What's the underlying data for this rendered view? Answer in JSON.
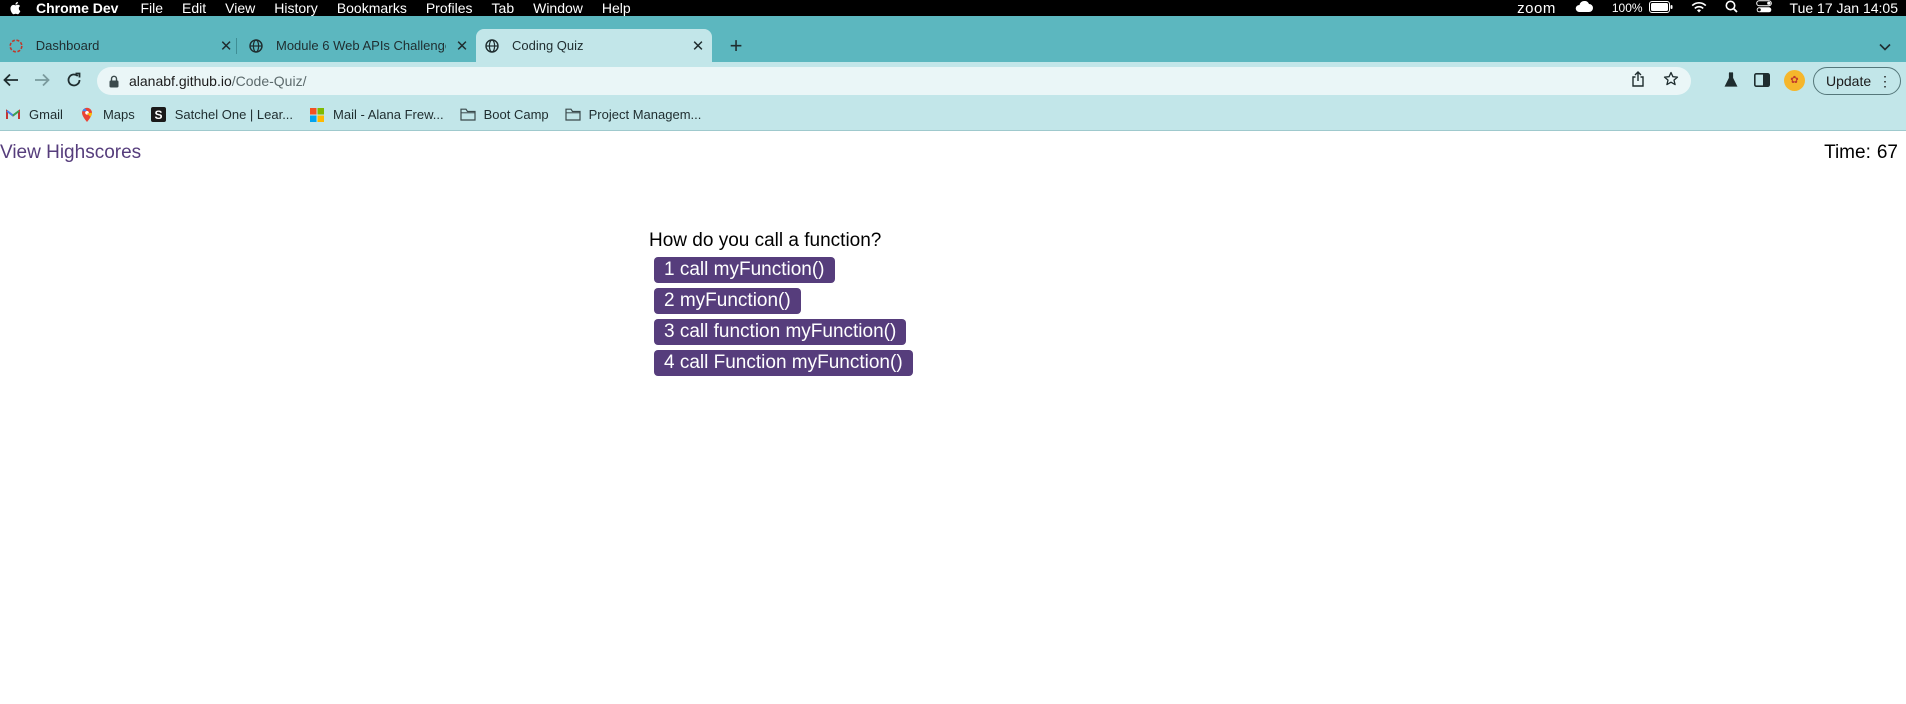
{
  "menubar": {
    "app_name": "Chrome Dev",
    "items": [
      "File",
      "Edit",
      "View",
      "History",
      "Bookmarks",
      "Profiles",
      "Tab",
      "Window",
      "Help"
    ],
    "zoom_label": "zoom",
    "battery_percent": "100%",
    "datetime": "Tue 17 Jan  14:05"
  },
  "tabs": [
    {
      "title": "Dashboard",
      "icon": "dashboard-icon",
      "active": false
    },
    {
      "title": "Module 6 Web APIs Challenge",
      "icon": "globe-icon",
      "active": false
    },
    {
      "title": "Coding Quiz",
      "icon": "globe-icon",
      "active": true
    }
  ],
  "toolbar": {
    "url_host": "alanabf.github.io",
    "url_path": "/Code-Quiz/",
    "update_label": "Update"
  },
  "bookmarks": [
    {
      "label": "Gmail",
      "icon": "gmail-icon"
    },
    {
      "label": "Maps",
      "icon": "maps-icon"
    },
    {
      "label": "Satchel One | Lear...",
      "icon": "satchel-icon"
    },
    {
      "label": "Mail - Alana Frew...",
      "icon": "microsoft-icon"
    },
    {
      "label": "Boot Camp",
      "icon": "folder-icon"
    },
    {
      "label": "Project Managem...",
      "icon": "folder-icon"
    }
  ],
  "page": {
    "highscores_link": "View Highscores",
    "timer_label": "Time:",
    "timer_value": "67",
    "question": "How do you call a function?",
    "answers": [
      "1 call myFunction()",
      "2 myFunction()",
      "3 call function myFunction()",
      "4 call Function myFunction()"
    ]
  },
  "colors": {
    "accent": "#563d7c",
    "tabstrip": "#5cb7bf",
    "toolbar": "#c2e6e9"
  }
}
